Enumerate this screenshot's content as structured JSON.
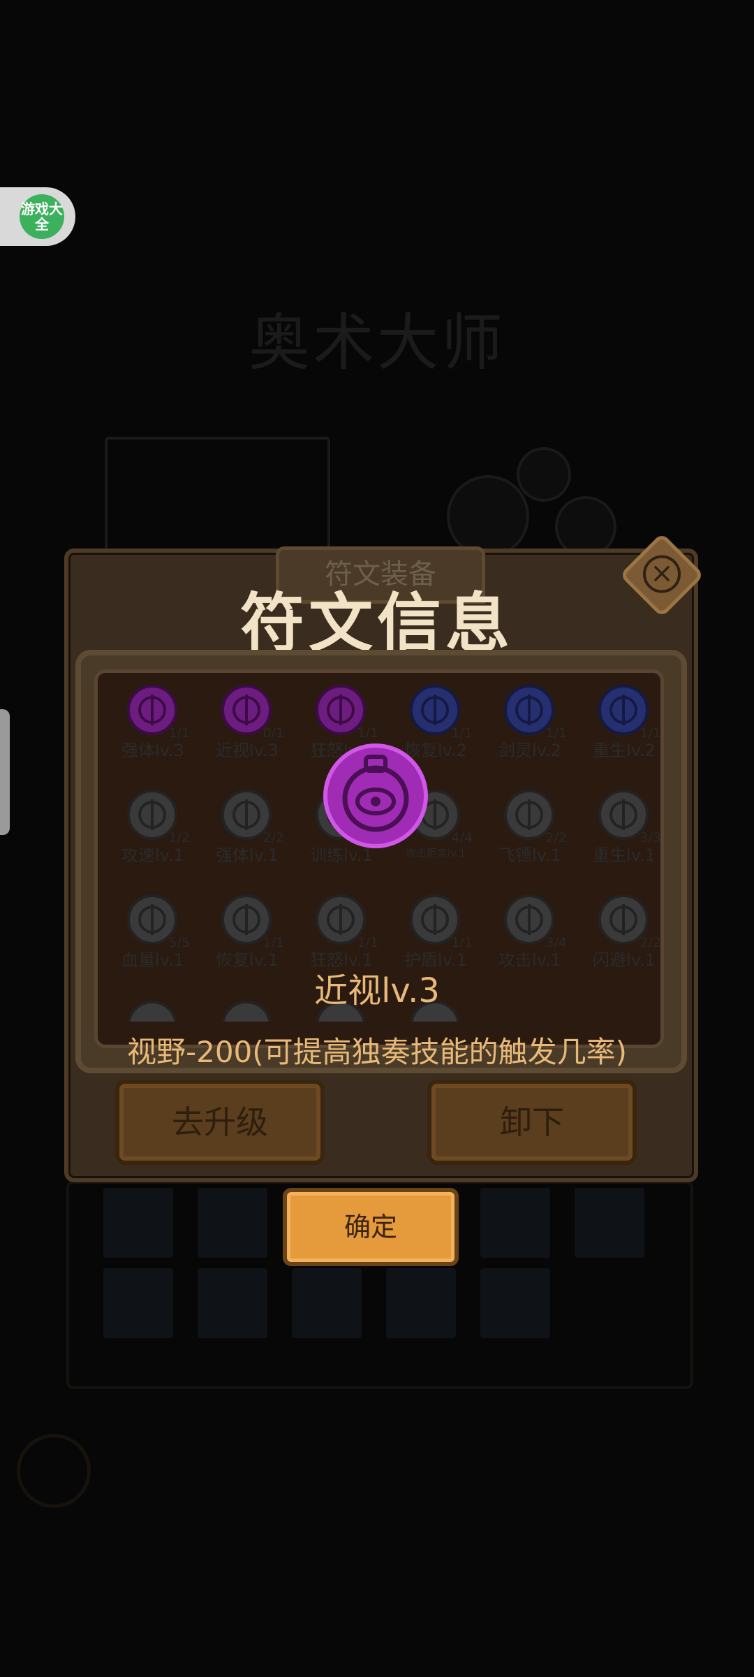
{
  "background": {
    "title": "奥术大师"
  },
  "badge": {
    "text": "游戏大全"
  },
  "dialog": {
    "tab_label": "符文装备",
    "title": "符文信息",
    "runes": [
      {
        "name": "强体lv.3",
        "count": "1/1",
        "tier": "purple"
      },
      {
        "name": "近视lv.3",
        "count": "0/1",
        "tier": "purple"
      },
      {
        "name": "狂怒lv.3",
        "count": "1/1",
        "tier": "purple"
      },
      {
        "name": "恢复lv.2",
        "count": "1/1",
        "tier": "blue"
      },
      {
        "name": "剑灵lv.2",
        "count": "1/1",
        "tier": "blue"
      },
      {
        "name": "重生lv.2",
        "count": "1/1",
        "tier": "blue"
      },
      {
        "name": "攻速lv.1",
        "count": "1/2",
        "tier": "gray"
      },
      {
        "name": "强体lv.1",
        "count": "2/2",
        "tier": "gray"
      },
      {
        "name": "训练lv.1",
        "count": "2/2",
        "tier": "gray"
      },
      {
        "name": "攻击距离lv.1",
        "count": "4/4",
        "tier": "gray"
      },
      {
        "name": "飞镖lv.1",
        "count": "2/2",
        "tier": "gray"
      },
      {
        "name": "重生lv.1",
        "count": "3/3",
        "tier": "gray"
      },
      {
        "name": "血量lv.1",
        "count": "5/5",
        "tier": "gray"
      },
      {
        "name": "恢复lv.1",
        "count": "1/1",
        "tier": "gray"
      },
      {
        "name": "狂怒lv.1",
        "count": "1/1",
        "tier": "gray"
      },
      {
        "name": "护盾lv.1",
        "count": "1/1",
        "tier": "gray"
      },
      {
        "name": "攻击lv.1",
        "count": "3/4",
        "tier": "gray"
      },
      {
        "name": "闪避lv.1",
        "count": "2/2",
        "tier": "gray"
      }
    ],
    "selected_rune": {
      "name": "近视lv.3",
      "description": "视野-200(可提高独奏技能的触发几率)"
    },
    "buttons": {
      "upgrade": "去升级",
      "unload": "卸下"
    }
  },
  "confirm_label": "确定",
  "colors": {
    "purple_rune": "#7a1f8f",
    "blue_rune": "#2a2f6e",
    "gray_rune": "#3d3d3d",
    "highlight_text": "#e9b978",
    "confirm_button": "#e59a3c"
  }
}
